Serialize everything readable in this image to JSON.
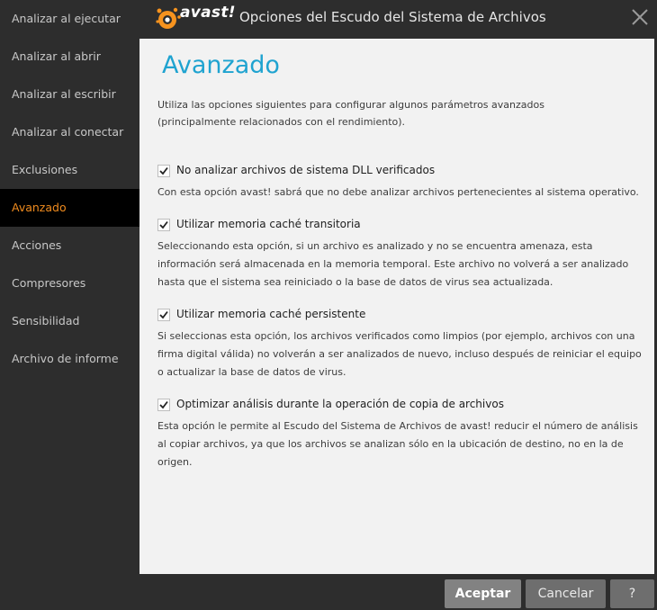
{
  "window": {
    "brand": "avast!",
    "title": "Opciones del Escudo del Sistema de Archivos"
  },
  "sidebar": {
    "items": [
      {
        "label": "Analizar al ejecutar"
      },
      {
        "label": "Analizar al abrir"
      },
      {
        "label": "Analizar al escribir"
      },
      {
        "label": "Analizar al conectar"
      },
      {
        "label": "Exclusiones"
      },
      {
        "label": "Avanzado",
        "active": true
      },
      {
        "label": "Acciones"
      },
      {
        "label": "Compresores"
      },
      {
        "label": "Sensibilidad"
      },
      {
        "label": "Archivo de informe"
      }
    ]
  },
  "main": {
    "heading": "Avanzado",
    "intro": "Utiliza las opciones siguientes para configurar algunos parámetros avanzados (principalmente relacionados con el rendimiento).",
    "options": [
      {
        "checked": true,
        "label": "No analizar archivos de sistema DLL verificados",
        "description": "Con esta opción avast! sabrá que no debe analizar archivos pertenecientes al sistema operativo."
      },
      {
        "checked": true,
        "label": "Utilizar memoria caché transitoria",
        "description": "Seleccionando esta opción, si un archivo es analizado y no se encuentra amenaza, esta información será almacenada en la memoria temporal. Este archivo no volverá a ser analizado hasta que el sistema sea reiniciado o la base de datos de virus sea actualizada."
      },
      {
        "checked": true,
        "label": "Utilizar memoria caché persistente",
        "description": "Si seleccionas esta opción, los archivos verificados como limpios (por ejemplo, archivos con una firma digital válida) no volverán a ser analizados de nuevo, incluso después de reiniciar el equipo o actualizar la base de datos de virus."
      },
      {
        "checked": true,
        "label": "Optimizar análisis durante la operación de copia de archivos",
        "description": "Esta opción le permite al Escudo del Sistema de Archivos de avast! reducir el número de análisis al copiar archivos, ya que los archivos se analizan sólo en la ubicación de destino, no en la de origen."
      }
    ]
  },
  "footer": {
    "accept_label": "Aceptar",
    "cancel_label": "Cancelar",
    "help_label": "?"
  },
  "colors": {
    "accent_orange": "#f08b1e",
    "heading_blue": "#1fa3d0",
    "sidebar_bg": "#2d2d2d",
    "content_bg": "#f2f2f2"
  }
}
